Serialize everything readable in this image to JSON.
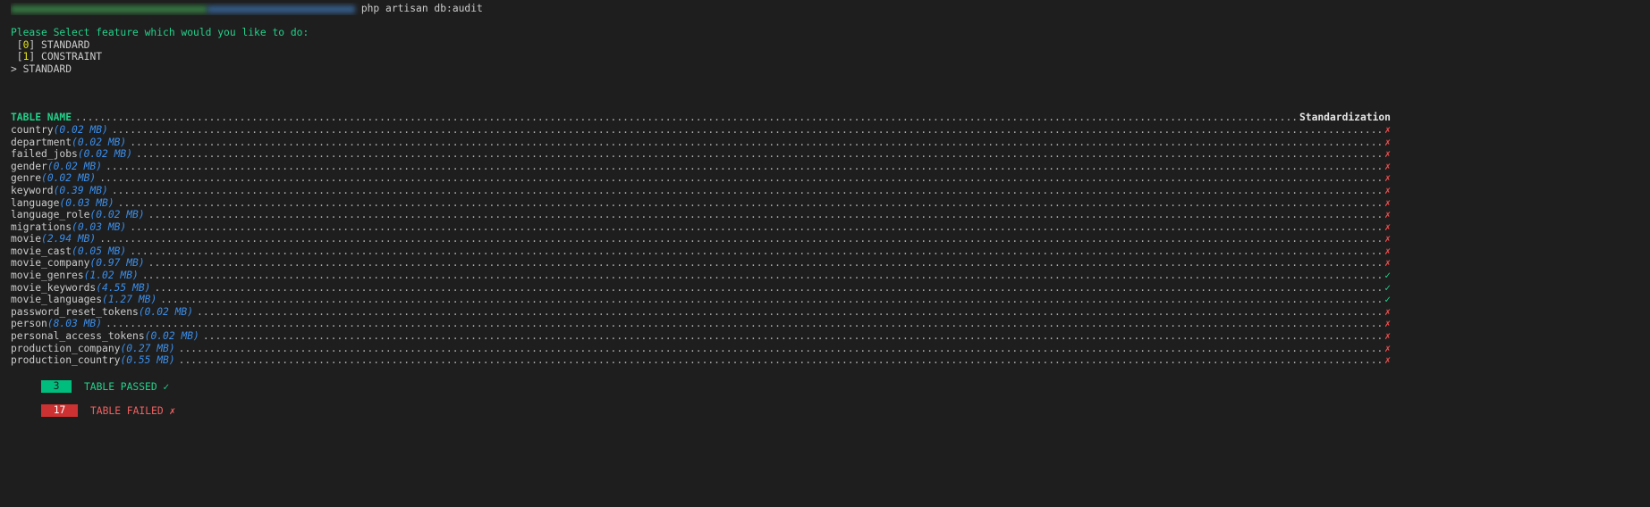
{
  "command": "php artisan db:audit",
  "prompt_question": "Please Select feature which would you like to do:",
  "options": [
    {
      "index": "0",
      "label": "STANDARD"
    },
    {
      "index": "1",
      "label": "CONSTRAINT"
    }
  ],
  "selected": "> STANDARD",
  "table": {
    "header_name": "TABLE NAME",
    "header_status": "Standardization",
    "rows": [
      {
        "name": "country",
        "size": "(0.02 MB)",
        "status": "✗"
      },
      {
        "name": "department",
        "size": "(0.02 MB)",
        "status": "✗"
      },
      {
        "name": "failed_jobs",
        "size": "(0.02 MB)",
        "status": "✗"
      },
      {
        "name": "gender",
        "size": "(0.02 MB)",
        "status": "✗"
      },
      {
        "name": "genre",
        "size": "(0.02 MB)",
        "status": "✗"
      },
      {
        "name": "keyword",
        "size": "(0.39 MB)",
        "status": "✗"
      },
      {
        "name": "language",
        "size": "(0.03 MB)",
        "status": "✗"
      },
      {
        "name": "language_role",
        "size": "(0.02 MB)",
        "status": "✗"
      },
      {
        "name": "migrations",
        "size": "(0.03 MB)",
        "status": "✗"
      },
      {
        "name": "movie",
        "size": "(2.94 MB)",
        "status": "✗"
      },
      {
        "name": "movie_cast",
        "size": "(0.05 MB)",
        "status": "✗"
      },
      {
        "name": "movie_company",
        "size": "(0.97 MB)",
        "status": "✗"
      },
      {
        "name": "movie_genres",
        "size": "(1.02 MB)",
        "status": "✓"
      },
      {
        "name": "movie_keywords",
        "size": "(4.55 MB)",
        "status": "✓"
      },
      {
        "name": "movie_languages",
        "size": "(1.27 MB)",
        "status": "✓"
      },
      {
        "name": "password_reset_tokens",
        "size": "(0.02 MB)",
        "status": "✗"
      },
      {
        "name": "person",
        "size": "(8.03 MB)",
        "status": "✗"
      },
      {
        "name": "personal_access_tokens",
        "size": "(0.02 MB)",
        "status": "✗"
      },
      {
        "name": "production_company",
        "size": "(0.27 MB)",
        "status": "✗"
      },
      {
        "name": "production_country",
        "size": "(0.55 MB)",
        "status": "✗"
      }
    ]
  },
  "summary": {
    "passed_count": "3",
    "passed_label": "TABLE PASSED ✓",
    "failed_count": "17",
    "failed_label": "TABLE FAILED ✗"
  },
  "colors": {
    "pass": "#23d18b",
    "fail": "#f14c4c",
    "pass_badge": "#00bc7d",
    "fail_badge": "#cd3131",
    "size": "#3b8eea",
    "background": "#1e1e1e"
  }
}
